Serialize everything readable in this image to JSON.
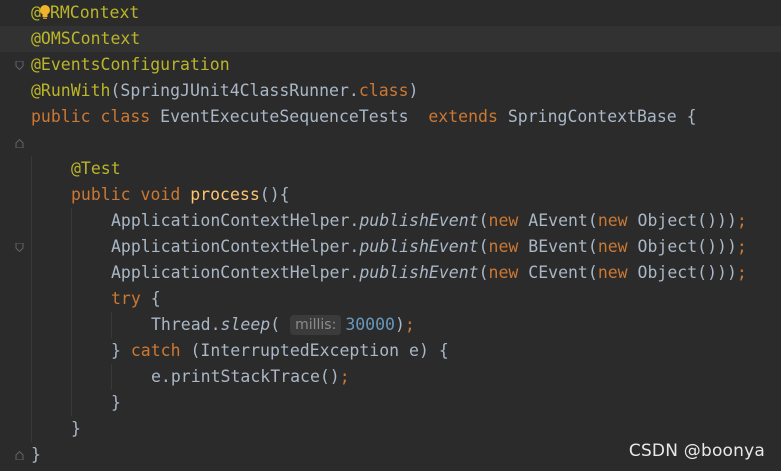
{
  "editor": {
    "colors": {
      "background": "#2b2b2b",
      "current_line": "#323232",
      "keyword": "#cc7832",
      "annotation": "#bbb529",
      "method_decl": "#ffc66d",
      "plain": "#a9b7c6",
      "number": "#6897bb",
      "hint": "#8c8c8c"
    },
    "lines": {
      "l1": {
        "at": "@",
        "rest": "RMContext"
      },
      "l2": "@OMSContext",
      "l3": "@EventsConfiguration",
      "l4": {
        "ann": "@RunWith",
        "open": "(SpringJUnit4ClassRunner.",
        "cls": "class",
        "close": ")"
      },
      "l5": {
        "k1": "public",
        "k2": "class",
        "name": " EventExecuteSequenceTests  ",
        "k3": "extends",
        "rest": " SpringContextBase {"
      },
      "l7": "@Test",
      "l8": {
        "k1": "public",
        "k2": "void",
        "m": "process",
        "rest": "(){"
      },
      "calls": [
        {
          "recv": "ApplicationContextHelper.",
          "method": "publishEvent",
          "open": "(",
          "k1": "new",
          "cls": " AEvent(",
          "k2": "new",
          "rest": " Object()))",
          "semi": ";"
        },
        {
          "recv": "ApplicationContextHelper.",
          "method": "publishEvent",
          "open": "(",
          "k1": "new",
          "cls": " BEvent(",
          "k2": "new",
          "rest": " Object()))",
          "semi": ";"
        },
        {
          "recv": "ApplicationContextHelper.",
          "method": "publishEvent",
          "open": "(",
          "k1": "new",
          "cls": " CEvent(",
          "k2": "new",
          "rest": " Object()))",
          "semi": ";"
        }
      ],
      "l12": {
        "k": "try",
        "rest": " {"
      },
      "l13": {
        "recv": "Thread.",
        "method": "sleep",
        "open": "(",
        "hint": "millis:",
        "num": "30000",
        "close": ")",
        "semi": ";"
      },
      "l14": {
        "close": "} ",
        "k": "catch",
        "rest": " (InterruptedException e) {"
      },
      "l15": {
        "call": "e.printStackTrace()",
        "semi": ";"
      },
      "l16": "}",
      "l17": "}",
      "l18": "}"
    },
    "icons": [
      "intention-bulb-icon",
      "fold-marker-icon"
    ]
  },
  "watermark": "CSDN @boonya"
}
